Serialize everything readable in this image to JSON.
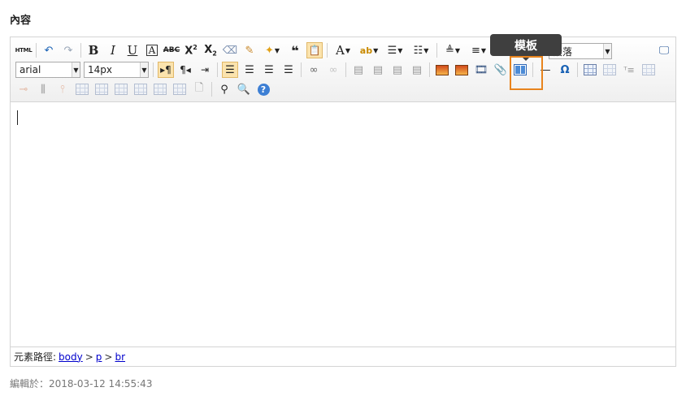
{
  "section": {
    "title": "內容"
  },
  "toolbar": {
    "html_label": "HTML",
    "font_family": "arial",
    "font_size": "14px",
    "paragraph": "段落"
  },
  "tooltip": {
    "label": "模板"
  },
  "path": {
    "label": "元素路徑:",
    "items": [
      "body",
      "p",
      "br"
    ],
    "separator": ">"
  },
  "footer": {
    "edited": "編輯於：2018-03-12 14:55:43"
  },
  "colors": {
    "tooltip_bg": "#3f3f3f",
    "highlight": "#e8841e",
    "link": "#0000cc"
  }
}
